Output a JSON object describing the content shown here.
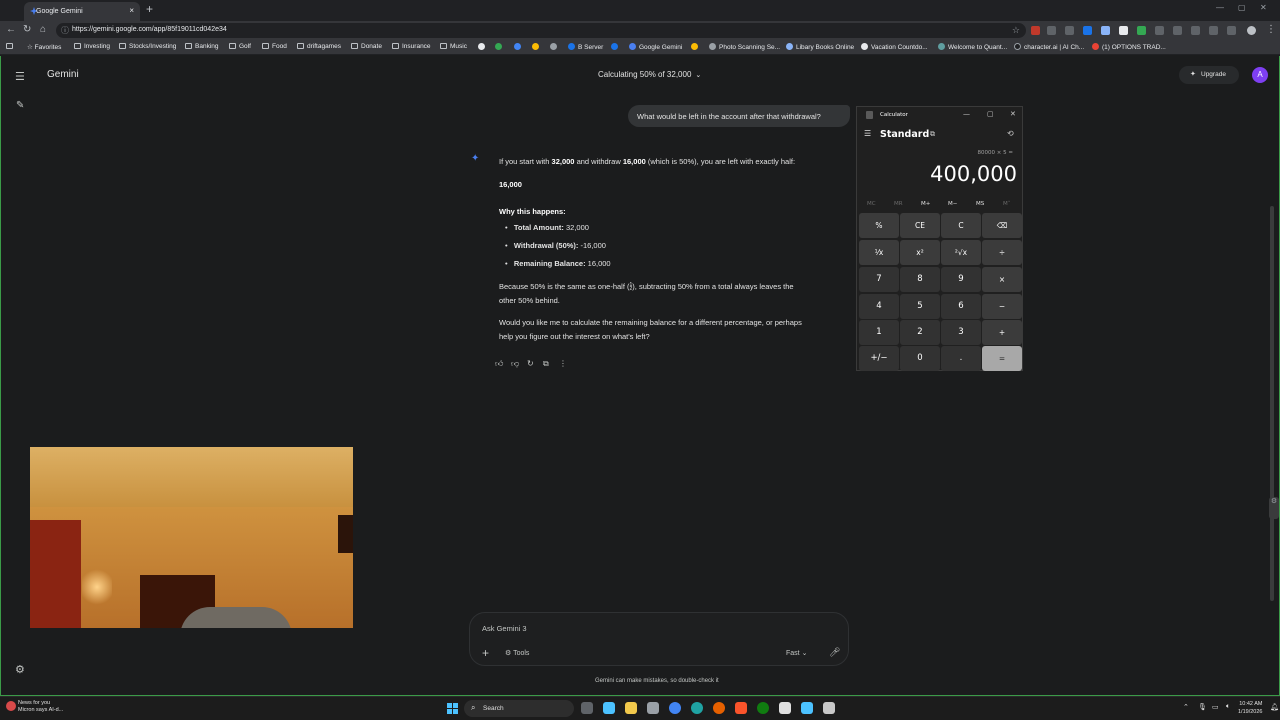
{
  "browser": {
    "tab_title": "Google Gemini",
    "url": "https://gemini.google.com/app/85f19011cd042e34",
    "bookmarks": [
      "Favorites",
      "Investing",
      "Stocks/Investing",
      "Banking",
      "Golf",
      "Food",
      "driftagames",
      "Donate",
      "Insurance",
      "Music",
      "B Server",
      "Google Gemini",
      "Photo Scanning Se...",
      "Libary Books Online",
      "Vacation Countdo...",
      "Welcome to Quant...",
      "character.ai | AI Ch...",
      "(1) OPTIONS TRAD..."
    ]
  },
  "app": {
    "brand": "Gemini",
    "conversation_title": "Calculating 50% of 32,000",
    "upgrade_label": "Upgrade",
    "avatar_letter": "A"
  },
  "chat": {
    "user_message": "What would be left in the account after that withdrawal?",
    "response": {
      "intro_pre": "If you start with ",
      "intro_amount": "32,000",
      "intro_mid": " and withdraw ",
      "intro_withdraw": "16,000",
      "intro_post": " (which is 50%), you are left with exactly half:",
      "result": "16,000",
      "why_heading": "Why this happens:",
      "bullets": [
        {
          "label": "Total Amount:",
          "value": " 32,000"
        },
        {
          "label": "Withdrawal (50%):",
          "value": " -16,000"
        },
        {
          "label": "Remaining Balance:",
          "value": " 16,000"
        }
      ],
      "explain_pre": "Because 50% is the same as one-half (",
      "frac_num": "1",
      "frac_den": "2",
      "explain_post": "), subtracting 50% from a total always leaves the",
      "explain_line2": "other 50% behind.",
      "followup_line1": "Would you like me to calculate the remaining balance for a different percentage, or perhaps",
      "followup_line2": "help you figure out the interest on what's left?"
    }
  },
  "input": {
    "placeholder": "Ask Gemini 3",
    "tools_label": "Tools",
    "mode_label": "Fast",
    "disclaimer": "Gemini can make mistakes, so double-check it"
  },
  "calculator": {
    "title": "Calculator",
    "mode": "Standard",
    "expression": "80000 × 5 =",
    "display": "400,000",
    "memory": [
      "MC",
      "MR",
      "M+",
      "M−",
      "MS",
      "M˅"
    ],
    "keys": [
      [
        "%",
        "CE",
        "C",
        "⌫"
      ],
      [
        "⅟x",
        "x²",
        "²√x",
        "÷"
      ],
      [
        "7",
        "8",
        "9",
        "×"
      ],
      [
        "4",
        "5",
        "6",
        "−"
      ],
      [
        "1",
        "2",
        "3",
        "+"
      ],
      [
        "+/−",
        "0",
        ".",
        "="
      ]
    ]
  },
  "taskbar": {
    "news_title": "News for you",
    "news_sub": "Micron says AI-d...",
    "search_label": "Search",
    "time": "10:42 AM",
    "date": "1/19/2026"
  },
  "colors": {
    "background": "#1b1c1d",
    "gemini_accent": "#4a7ff0",
    "avatar": "#7e3ff2",
    "screen_share_border": "#3b9b48"
  }
}
